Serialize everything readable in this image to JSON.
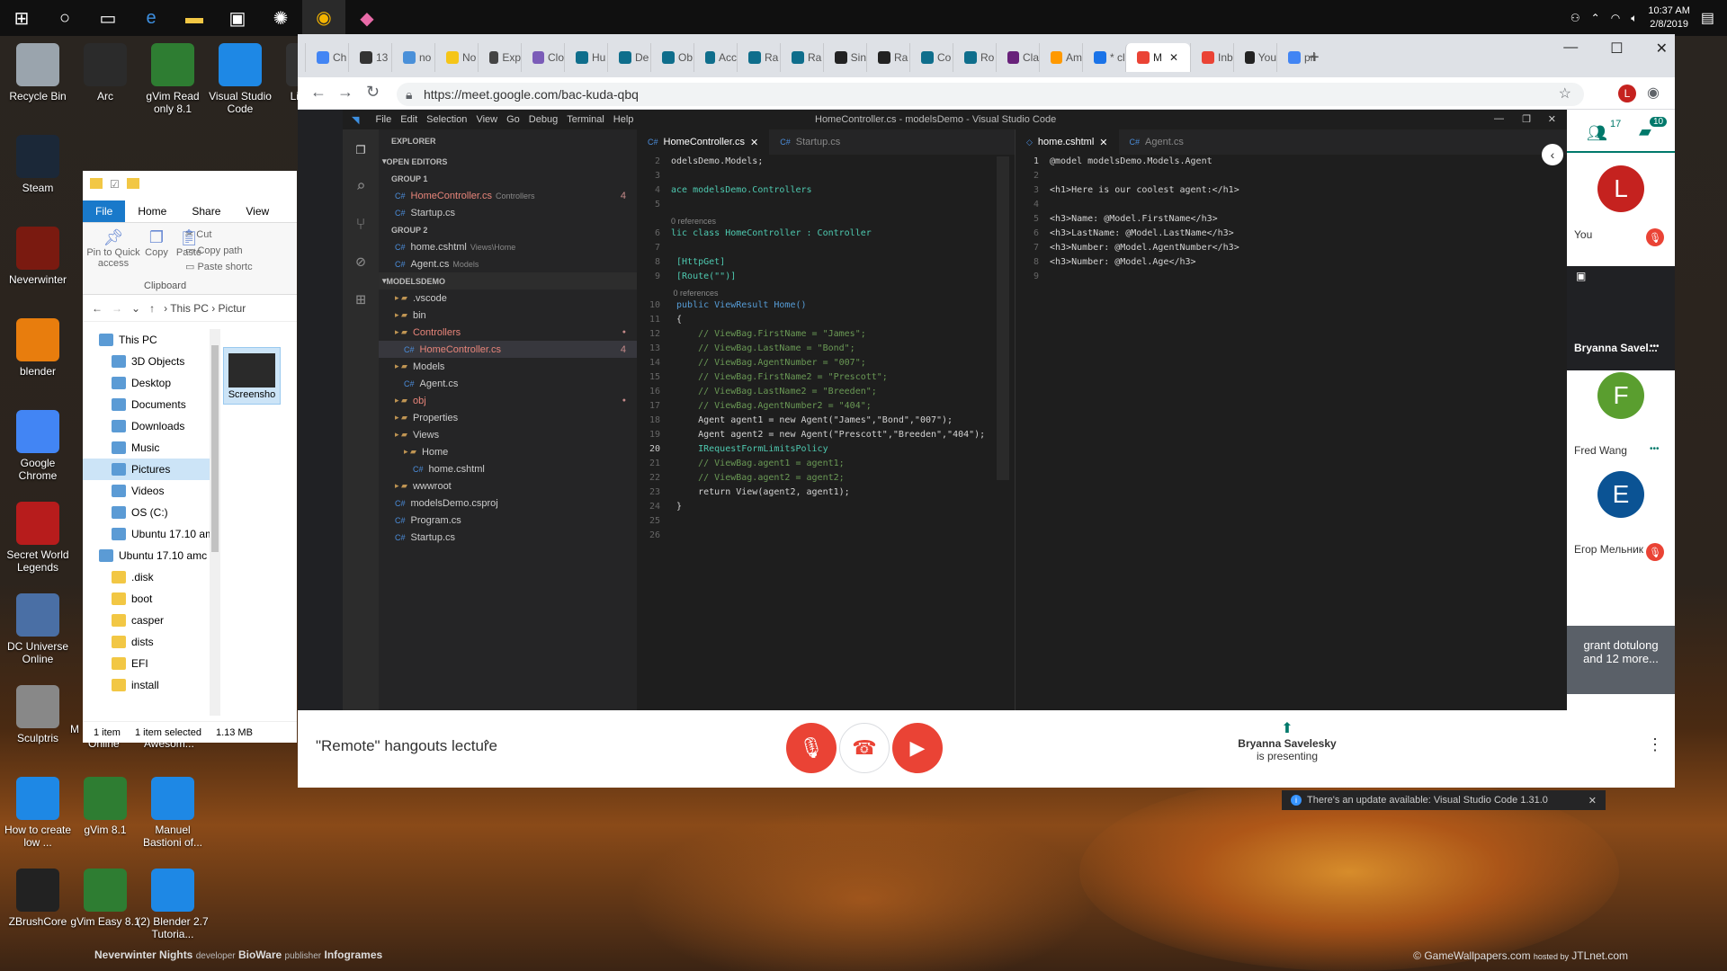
{
  "taskbar": {
    "clock_time": "10:37 AM",
    "clock_date": "2/8/2019"
  },
  "desktop": {
    "icons": [
      {
        "label": "Recycle Bin",
        "color": "#9aa4ad"
      },
      {
        "label": "Arc",
        "color": "#2b2b2b"
      },
      {
        "label": "gVim Read only 8.1",
        "color": "#2e7d32"
      },
      {
        "label": "Visual Studio Code",
        "color": "#1e88e5"
      },
      {
        "label": "Liv and",
        "color": "#333333"
      },
      {
        "label": "Steam",
        "color": "#1b2838"
      },
      {
        "label": "Neverwinter",
        "color": "#7a1a10"
      },
      {
        "label": "blender",
        "color": "#e87d0d"
      },
      {
        "label": "Google Chrome",
        "color": "#4285f4"
      },
      {
        "label": "Secret World Legends",
        "color": "#b71c1c"
      },
      {
        "label": "DC Universe Online",
        "color": "#4a6fa5"
      },
      {
        "label": "Sculptris",
        "color": "#888888"
      },
      {
        "label": "How to create low ...",
        "color": "#1e88e5"
      },
      {
        "label": "gVim 8.1",
        "color": "#2e7d32"
      },
      {
        "label": "Manuel Bastioni of...",
        "color": "#1e88e5"
      },
      {
        "label": "ZBrushCore",
        "color": "#222222"
      },
      {
        "label": "gVim Easy 8.1",
        "color": "#2e7d32"
      },
      {
        "label": "(2) Blender 2.7 Tutoria...",
        "color": "#1e88e5"
      }
    ],
    "partial_labels": [
      "M",
      "Online",
      "Awesom..."
    ],
    "wallpaper_caption": "Neverwinter Nights",
    "wallpaper_dev_label": "developer",
    "wallpaper_dev": "BioWare",
    "wallpaper_pub_label": "publisher",
    "wallpaper_pub": "Infogrames",
    "wallpaper_credit": "© GameWallpapers.com",
    "wallpaper_host": "hosted by",
    "wallpaper_host_name": "JTLnet.com"
  },
  "explorer": {
    "tabs": [
      "File",
      "Home",
      "Share",
      "View"
    ],
    "ribbon": {
      "pin": "Pin to Quick access",
      "copy": "Copy",
      "paste": "Paste",
      "cut": "Cut",
      "copy_path": "Copy path",
      "paste_shortcut": "Paste shortc",
      "group": "Clipboard"
    },
    "address": [
      "This PC",
      "Pictur"
    ],
    "tree": [
      {
        "label": "This PC",
        "indent": 0
      },
      {
        "label": "3D Objects",
        "indent": 1
      },
      {
        "label": "Desktop",
        "indent": 1
      },
      {
        "label": "Documents",
        "indent": 1
      },
      {
        "label": "Downloads",
        "indent": 1
      },
      {
        "label": "Music",
        "indent": 1
      },
      {
        "label": "Pictures",
        "indent": 1,
        "selected": true
      },
      {
        "label": "Videos",
        "indent": 1
      },
      {
        "label": "OS (C:)",
        "indent": 1
      },
      {
        "label": "Ubuntu 17.10 am",
        "indent": 1
      },
      {
        "label": "Ubuntu 17.10 amc",
        "indent": 0
      },
      {
        "label": ".disk",
        "indent": 1
      },
      {
        "label": "boot",
        "indent": 1
      },
      {
        "label": "casper",
        "indent": 1
      },
      {
        "label": "dists",
        "indent": 1
      },
      {
        "label": "EFI",
        "indent": 1
      },
      {
        "label": "install",
        "indent": 1
      }
    ],
    "thumb_label": "Screensho",
    "status_count": "1 item",
    "status_selected": "1 item selected",
    "status_size": "1.13 MB"
  },
  "chrome": {
    "tabs": [
      "Ch",
      "13",
      "no",
      "No",
      "Exp",
      "Clo",
      "Hu",
      "De",
      "Ob",
      "Acc",
      "Ra",
      "Ra",
      "Sin",
      "Ra",
      "Co",
      "Ro",
      "Cla",
      "Am",
      "* cl",
      "M",
      "Inb",
      "You",
      "pri"
    ],
    "tab_colors": [
      "#4285f4",
      "#333333",
      "#4a90d9",
      "#f5c518",
      "#444444",
      "#7b5cb8",
      "#0f6e8c",
      "#0f6e8c",
      "#0f6e8c",
      "#0f6e8c",
      "#0f6e8c",
      "#0f6e8c",
      "#222222",
      "#222222",
      "#0f6e8c",
      "#0f6e8c",
      "#68217a",
      "#ff9900",
      "#1a73e8",
      "#ea4335",
      "#ea4335",
      "#222222",
      "#4285f4"
    ],
    "url": "https://meet.google.com/bac-kuda-qbq",
    "profile_initial": "L"
  },
  "vscode": {
    "menu": [
      "File",
      "Edit",
      "Selection",
      "View",
      "Go",
      "Debug",
      "Terminal",
      "Help"
    ],
    "window_title": "HomeController.cs - modelsDemo - Visual Studio Code",
    "explorer_title": "EXPLORER",
    "open_editors": "OPEN EDITORS",
    "group1": "GROUP 1",
    "group2": "GROUP 2",
    "project": "MODELSDEMO",
    "files_group1": [
      {
        "name": "HomeController.cs",
        "sub": "Controllers",
        "badge": "4"
      },
      {
        "name": "Startup.cs",
        "sub": "",
        "badge": ""
      }
    ],
    "files_group2": [
      {
        "name": "home.cshtml",
        "sub": "Views\\Home"
      },
      {
        "name": "Agent.cs",
        "sub": "Models"
      }
    ],
    "tree": [
      {
        "name": ".vscode",
        "indent": 1,
        "folder": true
      },
      {
        "name": "bin",
        "indent": 1,
        "folder": true
      },
      {
        "name": "Controllers",
        "indent": 1,
        "folder": true,
        "modified": true
      },
      {
        "name": "HomeController.cs",
        "indent": 2,
        "badge": "4",
        "modified": true,
        "selected": true
      },
      {
        "name": "Models",
        "indent": 1,
        "folder": true
      },
      {
        "name": "Agent.cs",
        "indent": 2
      },
      {
        "name": "obj",
        "indent": 1,
        "folder": true,
        "modified": true
      },
      {
        "name": "Properties",
        "indent": 1,
        "folder": true
      },
      {
        "name": "Views",
        "indent": 1,
        "folder": true
      },
      {
        "name": "Home",
        "indent": 2,
        "folder": true
      },
      {
        "name": "home.cshtml",
        "indent": 3
      },
      {
        "name": "wwwroot",
        "indent": 1,
        "folder": true
      },
      {
        "name": "modelsDemo.csproj",
        "indent": 1
      },
      {
        "name": "Program.cs",
        "indent": 1
      },
      {
        "name": "Startup.cs",
        "indent": 1
      }
    ],
    "editor1_tabs": [
      "HomeController.cs",
      "Startup.cs"
    ],
    "editor2_tabs": [
      "home.cshtml",
      "Agent.cs"
    ],
    "editor1_lines": [
      {
        "n": "2",
        "t": "odelsDemo.Models;",
        "c": "tx"
      },
      {
        "n": "3",
        "t": "",
        "c": "tx"
      },
      {
        "n": "4",
        "t": "ace modelsDemo.Controllers",
        "c": "ty"
      },
      {
        "n": "5",
        "t": "",
        "c": "tx"
      },
      {
        "n": "",
        "t": "0 references",
        "c": "ref"
      },
      {
        "n": "6",
        "t": "lic class HomeController : Controller",
        "c": "ty"
      },
      {
        "n": "7",
        "t": "",
        "c": "tx"
      },
      {
        "n": "8",
        "t": " [HttpGet]",
        "c": "ty"
      },
      {
        "n": "9",
        "t": " [Route(\"\")]",
        "c": "ty"
      },
      {
        "n": "",
        "t": " 0 references",
        "c": "ref"
      },
      {
        "n": "10",
        "t": " public ViewResult Home()",
        "c": "kw"
      },
      {
        "n": "11",
        "t": " {",
        "c": "tx"
      },
      {
        "n": "12",
        "t": "     // ViewBag.FirstName = \"James\";",
        "c": "cm"
      },
      {
        "n": "13",
        "t": "     // ViewBag.LastName = \"Bond\";",
        "c": "cm"
      },
      {
        "n": "14",
        "t": "     // ViewBag.AgentNumber = \"007\";",
        "c": "cm"
      },
      {
        "n": "15",
        "t": "     // ViewBag.FirstName2 = \"Prescott\";",
        "c": "cm"
      },
      {
        "n": "16",
        "t": "     // ViewBag.LastName2 = \"Breeden\";",
        "c": "cm"
      },
      {
        "n": "17",
        "t": "     // ViewBag.AgentNumber2 = \"404\";",
        "c": "cm"
      },
      {
        "n": "18",
        "t": "     Agent agent1 = new Agent(\"James\",\"Bond\",\"007\");",
        "c": "tx"
      },
      {
        "n": "19",
        "t": "     Agent agent2 = new Agent(\"Prescott\",\"Breeden\",\"404\");",
        "c": "tx"
      },
      {
        "n": "20",
        "t": "     IRequestFormLimitsPolicy",
        "c": "ty"
      },
      {
        "n": "21",
        "t": "     // ViewBag.agent1 = agent1;",
        "c": "cm"
      },
      {
        "n": "22",
        "t": "     // ViewBag.agent2 = agent2;",
        "c": "cm"
      },
      {
        "n": "23",
        "t": "     return View(agent2, agent1);",
        "c": "tx"
      },
      {
        "n": "24",
        "t": " }",
        "c": "tx"
      },
      {
        "n": "25",
        "t": "",
        "c": "tx"
      },
      {
        "n": "26",
        "t": "",
        "c": "tx"
      }
    ],
    "editor2_lines": [
      {
        "n": "1",
        "t": "@model modelsDemo.Models.Agent",
        "c": "tx"
      },
      {
        "n": "2",
        "t": "",
        "c": "tx"
      },
      {
        "n": "3",
        "t": "<h1>Here is our coolest agent:</h1>",
        "c": "tx"
      },
      {
        "n": "4",
        "t": "",
        "c": "tx"
      },
      {
        "n": "5",
        "t": "<h3>Name: @Model.FirstName</h3>",
        "c": "tx"
      },
      {
        "n": "6",
        "t": "<h3>LastName: @Model.LastName</h3>",
        "c": "tx"
      },
      {
        "n": "7",
        "t": "<h3>Number: @Model.AgentNumber</h3>",
        "c": "tx"
      },
      {
        "n": "8",
        "t": "<h3>Number: @Model.Age</h3>",
        "c": "tx"
      },
      {
        "n": "9",
        "t": "",
        "c": "tx"
      }
    ],
    "notification": "There's an update available: Visual Studio Code 1.31.0"
  },
  "meet": {
    "people_count": "17",
    "chat_count": "10",
    "participants": [
      {
        "name": "You",
        "initial": "L",
        "color": "#c5221f",
        "muted": true
      },
      {
        "name": "Bryanna Savel...",
        "initial": "",
        "color": "#202124",
        "muted": false
      },
      {
        "name": "Fred Wang",
        "initial": "F",
        "color": "#5a9e2f",
        "muted": false
      },
      {
        "name": "Егор Мельник",
        "initial": "E",
        "color": "#0b5394",
        "muted": true
      }
    ],
    "more": "grant dotulong and 12 more...",
    "meeting_title": "\"Remote\" hangouts lecture",
    "presenter_name": "Bryanna Savelesky",
    "presenter_status": "is presenting"
  }
}
